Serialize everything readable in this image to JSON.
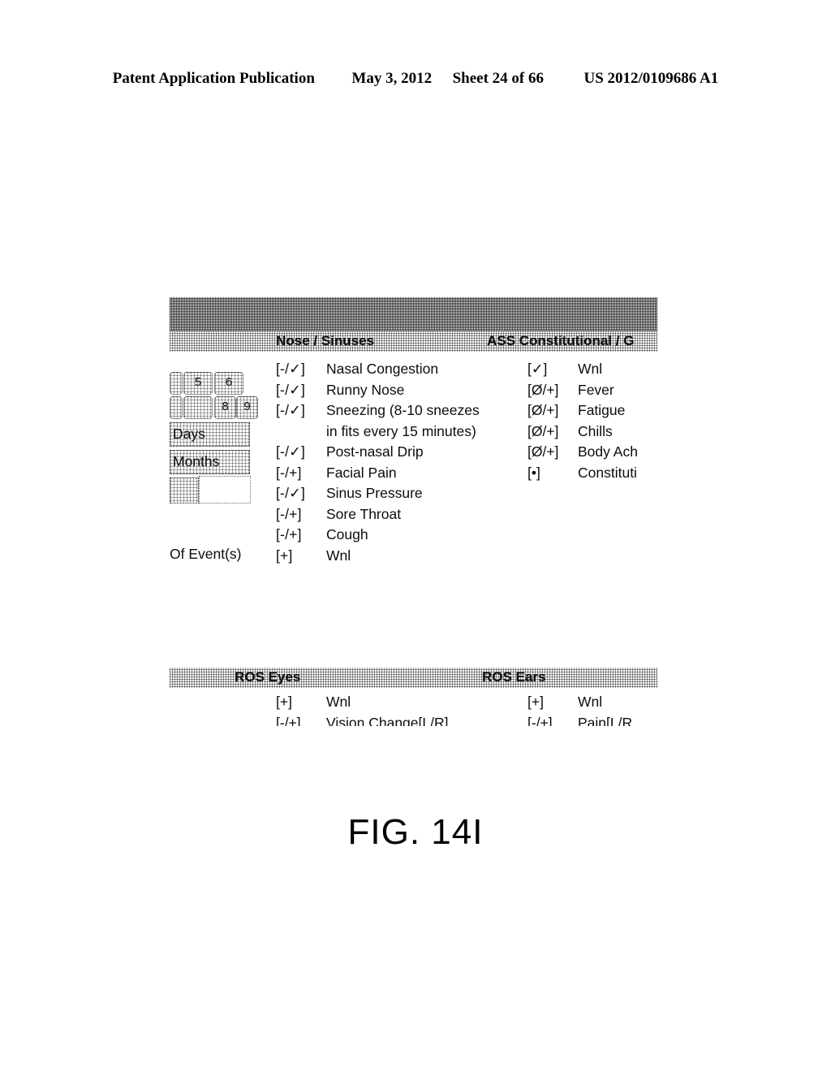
{
  "page_header": {
    "publication": "Patent Application Publication",
    "date": "May 3, 2012",
    "sheet": "Sheet 24 of 66",
    "patent_number": "US 2012/0109686 A1"
  },
  "figure": {
    "caption": "FIG. 14I"
  },
  "main_panel": {
    "left_section_title": "Nose / Sinuses",
    "right_section_title": "ASS Constitutional / G",
    "duration_control": {
      "keys": [
        {
          "label": "5"
        },
        {
          "label": "6"
        },
        {
          "label": ""
        },
        {
          "label": "8"
        },
        {
          "label": "9"
        }
      ],
      "days_label": "Days",
      "months_label": "Months",
      "value_field": "",
      "of_events_label": "Of Event(s)"
    },
    "nose_sinuses_items": [
      {
        "mark": "[-/✓]",
        "label": "Nasal Congestion",
        "sub": ""
      },
      {
        "mark": "[-/✓]",
        "label": "Runny Nose",
        "sub": ""
      },
      {
        "mark": "[-/✓]",
        "label": "Sneezing (8-10 sneezes",
        "sub": "in fits every 15 minutes)"
      },
      {
        "mark": "[-/✓]",
        "label": "Post-nasal Drip",
        "sub": ""
      },
      {
        "mark": "[-/+]",
        "label": "Facial Pain",
        "sub": ""
      },
      {
        "mark": "[-/✓]",
        "label": "Sinus Pressure",
        "sub": ""
      },
      {
        "mark": "[-/+]",
        "label": "Sore Throat",
        "sub": ""
      },
      {
        "mark": "[-/+]",
        "label": "Cough",
        "sub": ""
      },
      {
        "mark": "[+]",
        "label": "Wnl",
        "sub": ""
      }
    ],
    "constitutional_items": [
      {
        "mark": "[✓]",
        "label": "Wnl"
      },
      {
        "mark": "[Ø/+]",
        "label": "Fever"
      },
      {
        "mark": "[Ø/+]",
        "label": "Fatigue"
      },
      {
        "mark": "[Ø/+]",
        "label": "Chills"
      },
      {
        "mark": "[Ø/+]",
        "label": "Body Ach"
      },
      {
        "mark": "[•]",
        "label": "Constituti"
      }
    ]
  },
  "eyes_ears_panel": {
    "eyes_section_title": "ROS Eyes",
    "ears_section_title": "ROS Ears",
    "eyes_items": [
      {
        "mark": "[+]",
        "label": "Wnl"
      },
      {
        "mark": "[-/+]",
        "label": "Vision Change[L/R]"
      }
    ],
    "ears_items": [
      {
        "mark": "[+]",
        "label": "Wnl"
      },
      {
        "mark": "[-/+]",
        "label": "Pain[L/R"
      }
    ]
  }
}
